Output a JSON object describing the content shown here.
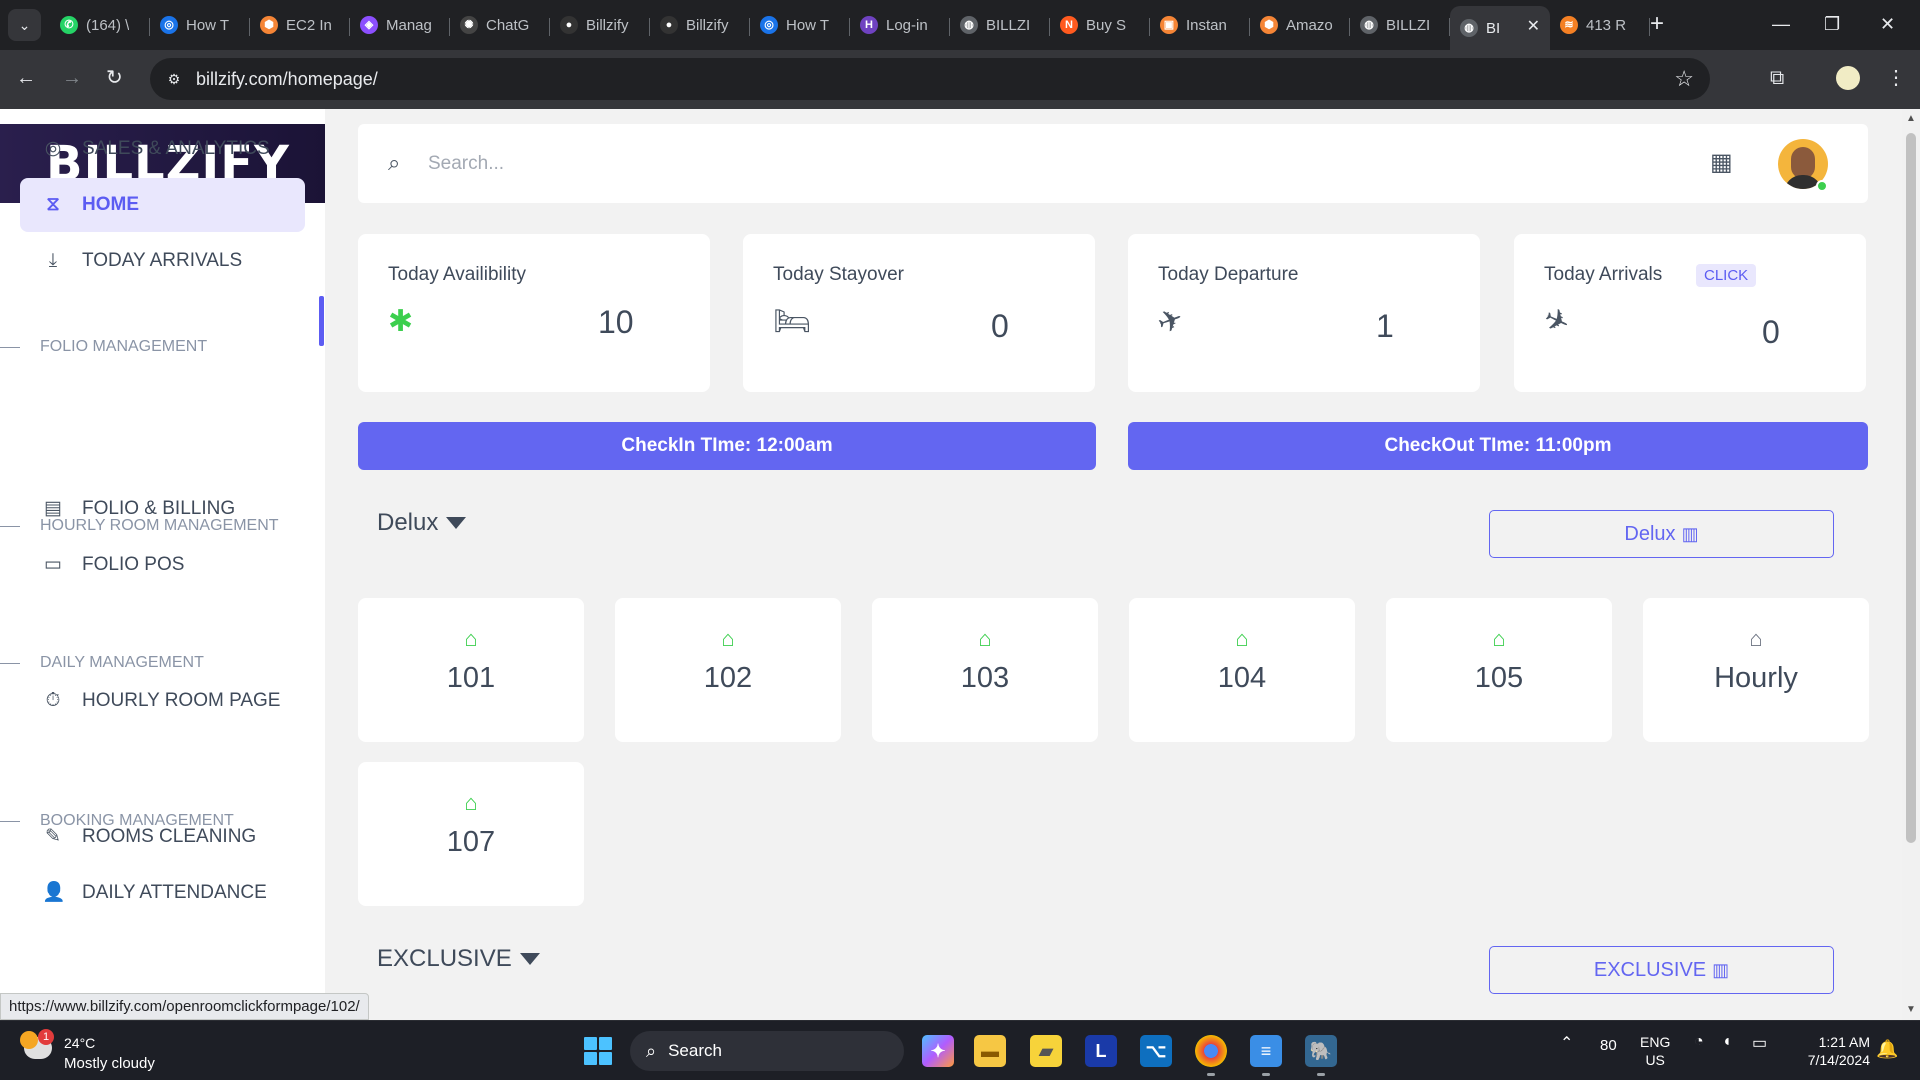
{
  "browser": {
    "tabs": [
      {
        "title": "(164) \\",
        "fav_color": "#25d366",
        "fav_glyph": "✆"
      },
      {
        "title": "How T",
        "fav_color": "#1a73e8",
        "fav_glyph": "◎"
      },
      {
        "title": "EC2 In",
        "fav_color": "#f58536",
        "fav_glyph": "⬢"
      },
      {
        "title": "Manag",
        "fav_color": "#8c4fff",
        "fav_glyph": "◈"
      },
      {
        "title": "ChatG",
        "fav_color": "#444444",
        "fav_glyph": "✺"
      },
      {
        "title": "Billzify",
        "fav_color": "#333333",
        "fav_glyph": "●"
      },
      {
        "title": "Billzify",
        "fav_color": "#333333",
        "fav_glyph": "●"
      },
      {
        "title": "How T",
        "fav_color": "#1a73e8",
        "fav_glyph": "◎"
      },
      {
        "title": "Log-in",
        "fav_color": "#6f42c1",
        "fav_glyph": "H"
      },
      {
        "title": "BILLZI",
        "fav_color": "#5f6368",
        "fav_glyph": "◍"
      },
      {
        "title": "Buy S",
        "fav_color": "#ff5a1f",
        "fav_glyph": "N"
      },
      {
        "title": "Instan",
        "fav_color": "#f58536",
        "fav_glyph": "▣"
      },
      {
        "title": "Amazo",
        "fav_color": "#f58536",
        "fav_glyph": "⬢"
      },
      {
        "title": "BILLZI",
        "fav_color": "#5f6368",
        "fav_glyph": "◍"
      },
      {
        "title": "BI",
        "fav_color": "#5f6368",
        "fav_glyph": "◍",
        "active": true
      },
      {
        "title": "413 R",
        "fav_color": "#f48024",
        "fav_glyph": "≋"
      }
    ],
    "url": "billzify.com/homepage/",
    "status_url": "https://www.billzify.com/openroomclickformpage/102/"
  },
  "logo": {
    "text": "BILLZIFY"
  },
  "sidebar": {
    "items": [
      {
        "label": "SALES & ANALYTICS",
        "icon": "analytics-icon",
        "glyph": "◎"
      },
      {
        "label": "HOME",
        "icon": "home-icon",
        "glyph": "⧖",
        "active": true
      },
      {
        "label": "TODAY ARRIVALS",
        "icon": "arrival-icon",
        "glyph": "⤓"
      },
      {
        "label": "FOLIO & BILLING",
        "icon": "billing-icon",
        "glyph": "▤"
      },
      {
        "label": "FOLIO POS",
        "icon": "pos-icon",
        "glyph": "▭"
      },
      {
        "label": "HOURLY ROOM PAGE",
        "icon": "timer-icon",
        "glyph": "⏱"
      },
      {
        "label": "ROOMS CLEANING",
        "icon": "brush-icon",
        "glyph": "✎"
      },
      {
        "label": "DAILY ATTENDANCE",
        "icon": "user-check-icon",
        "glyph": "👤"
      }
    ],
    "sections": [
      "FOLIO MANAGEMENT",
      "HOURLY ROOM MANAGEMENT",
      "DAILY MANAGEMENT",
      "BOOKING MANAGEMENT"
    ]
  },
  "search": {
    "placeholder": "Search..."
  },
  "stats": [
    {
      "label": "Today Availibility",
      "value": "10",
      "icon": "discount-badge-icon",
      "glyph": "✱",
      "color": "#3ccf4e"
    },
    {
      "label": "Today Stayover",
      "value": "0",
      "icon": "bed-icon",
      "glyph": "🛏",
      "color": "#4a5563"
    },
    {
      "label": "Today Departure",
      "value": "1",
      "icon": "plane-departure-icon",
      "glyph": "✈",
      "color": "#4a5563"
    },
    {
      "label": "Today Arrivals",
      "value": "0",
      "icon": "plane-arrival-icon",
      "glyph": "✈",
      "color": "#4a5563",
      "badge": "CLICK"
    }
  ],
  "times": {
    "checkin": "CheckIn TIme: 12:00am",
    "checkout": "CheckOut TIme: 11:00pm"
  },
  "categories": [
    {
      "name": "Delux",
      "button": "Delux",
      "rooms": [
        {
          "label": "101",
          "status_color": "#3ccf4e"
        },
        {
          "label": "102",
          "status_color": "#3ccf4e"
        },
        {
          "label": "103",
          "status_color": "#3ccf4e"
        },
        {
          "label": "104",
          "status_color": "#3ccf4e"
        },
        {
          "label": "105",
          "status_color": "#3ccf4e"
        },
        {
          "label": "Hourly",
          "status_color": "#6b7280"
        },
        {
          "label": "107",
          "status_color": "#3ccf4e"
        }
      ]
    },
    {
      "name": "EXCLUSIVE",
      "button": "EXCLUSIVE",
      "rooms": []
    }
  ],
  "taskbar": {
    "weather_temp": "24°C",
    "weather_desc": "Mostly cloudy",
    "weather_badge": "1",
    "search_label": "Search",
    "battery_text": "80",
    "lang_1": "ENG",
    "lang_2": "US",
    "time": "1:21 AM",
    "date": "7/14/2024"
  },
  "colors": {
    "accent": "#6366f1",
    "available": "#3ccf4e",
    "sidebar_bg": "#ffffff",
    "page_bg": "#f2f2f2"
  }
}
